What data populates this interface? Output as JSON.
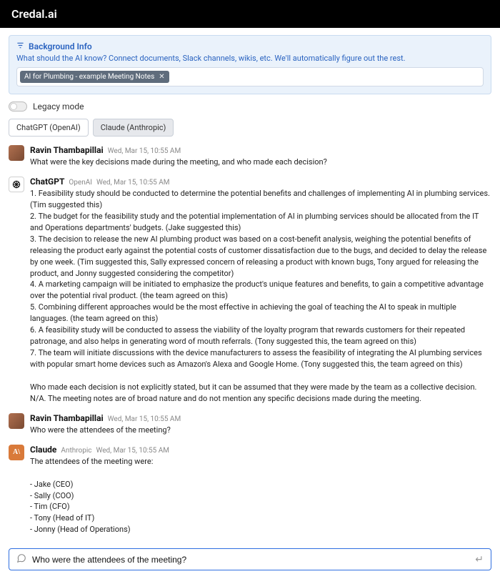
{
  "brand": "Credal.ai",
  "infoPanel": {
    "title": "Background Info",
    "description": "What should the AI know? Connect documents, Slack channels, wikis, etc. We'll automatically figure out the rest.",
    "chip": "AI for Plumbing - example Meeting Notes"
  },
  "legacyLabel": "Legacy mode",
  "modelTabs": {
    "chatgpt": "ChatGPT (OpenAI)",
    "claude": "Claude (Anthropic)"
  },
  "messages": [
    {
      "author": "Ravin Thambapillai",
      "provider": "",
      "timestamp": "Wed, Mar 15, 10:55 AM",
      "text": "What were the key decisions made during the meeting, and who made each decision?"
    },
    {
      "author": "ChatGPT",
      "provider": "OpenAI",
      "timestamp": "Wed, Mar 15, 10:55 AM",
      "text": "1. Feasibility study should be conducted to determine the potential benefits and challenges of implementing AI in plumbing services. (Tim suggested this)\n2. The budget for the feasibility study and the potential implementation of AI in plumbing services should be allocated from the IT and Operations departments' budgets. (Jake suggested this)\n3. The decision to release the new AI plumbing product was based on a cost-benefit analysis, weighing the potential benefits of releasing the product early against the potential costs of customer dissatisfaction due to the bugs, and decided to delay the release by one week. (Tim suggested this, Sally expressed concern of releasing a product with known bugs, Tony argued for releasing the product, and Jonny suggested considering the competitor)\n4. A marketing campaign will be initiated to emphasize the product's unique features and benefits, to gain a competitive advantage over the potential rival product. (the team agreed on this)\n5. Combining different approaches would be the most effective in achieving the goal of teaching the AI to speak in multiple languages. (the team agreed on this)\n6. A feasibility study will be conducted to assess the viability of the loyalty program that rewards customers for their repeated patronage, and also helps in generating word of mouth referrals. (Tony suggested this, the team agreed on this)\n7. The team will initiate discussions with the device manufacturers to assess the feasibility of integrating the AI plumbing services with popular smart home devices such as Amazon's Alexa and Google Home. (Tony suggested this, the team agreed on this)\n\nWho made each decision is not explicitly stated, but it can be assumed that they were made by the team as a collective decision.\nN/A. The meeting notes are of broad nature and do not mention any specific decisions made during the meeting."
    },
    {
      "author": "Ravin Thambapillai",
      "provider": "",
      "timestamp": "Wed, Mar 15, 10:55 AM",
      "text": "Who were the attendees of the meeting?"
    },
    {
      "author": "Claude",
      "provider": "Anthropic",
      "timestamp": "Wed, Mar 15, 10:55 AM",
      "text": "The attendees of the meeting were:\n\n- Jake (CEO)\n- Sally (COO)\n- Tim (CFO)\n- Tony (Head of IT)\n- Jonny (Head of Operations)"
    }
  ],
  "composer": {
    "value": "Who were the attendees of the meeting?"
  },
  "avatarLabels": {
    "claude": "A\\"
  }
}
